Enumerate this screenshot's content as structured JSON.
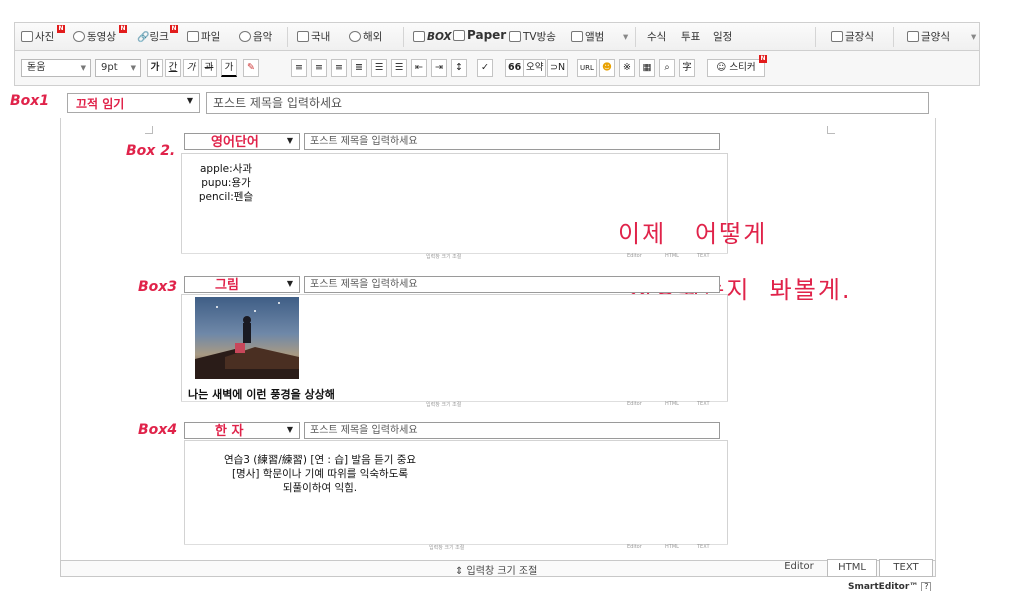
{
  "toolbar_top": {
    "items": [
      "사진",
      "동영상",
      "링크",
      "파일",
      "음악",
      "국내",
      "해외",
      "BOX",
      "Paper",
      "TV방송",
      "앨범",
      "수식",
      "투표",
      "일정",
      "글장식",
      "글양식"
    ]
  },
  "toolbar_format": {
    "font": "돋움",
    "size": "9pt",
    "buttons": [
      "가",
      "간",
      "가",
      "과",
      "가"
    ],
    "extra": [
      "66",
      "오약",
      "⊃N",
      "URL",
      "스티커"
    ]
  },
  "box1": {
    "annotation": "Box1",
    "category": "끄적 임기",
    "title_placeholder": "포스트 제목을 입력하세요"
  },
  "box2": {
    "annotation": "Box 2.",
    "category": "영어단어",
    "title_placeholder": "포스트 제목을 입력하세요",
    "lines": [
      "apple:사과",
      "pupu:용가",
      "pencil:펜슬"
    ]
  },
  "box3": {
    "annotation": "Box3",
    "category": "그림",
    "title_placeholder": "포스트 제목을 입력하세요",
    "caption": "나는 새벽에 이런 풍경을 상상해"
  },
  "box4": {
    "annotation": "Box4",
    "category": "한 자",
    "title_placeholder": "포스트 제목을 입력하세요",
    "lines": [
      "연습3 (練習/練習) [연 : 습]  발음 듣기 중요",
      "[명사] 학문이나 기예 따위를 익숙하도록",
      "되풀이하여 익힘."
    ]
  },
  "note": {
    "line1": "이제   어떻게",
    "line2": "저장되는지  봐볼게."
  },
  "inner_footer": {
    "resize": "입력창 크기 조절",
    "tabs": [
      "Editor",
      "HTML",
      "TEXT"
    ]
  },
  "bottom": {
    "resize_label": "⇕ 입력창 크기 조절",
    "tabs": [
      "Editor",
      "HTML",
      "TEXT"
    ],
    "brand": "SmartEditor™",
    "help": "?"
  },
  "colors": {
    "annotation": "#e0234a"
  }
}
